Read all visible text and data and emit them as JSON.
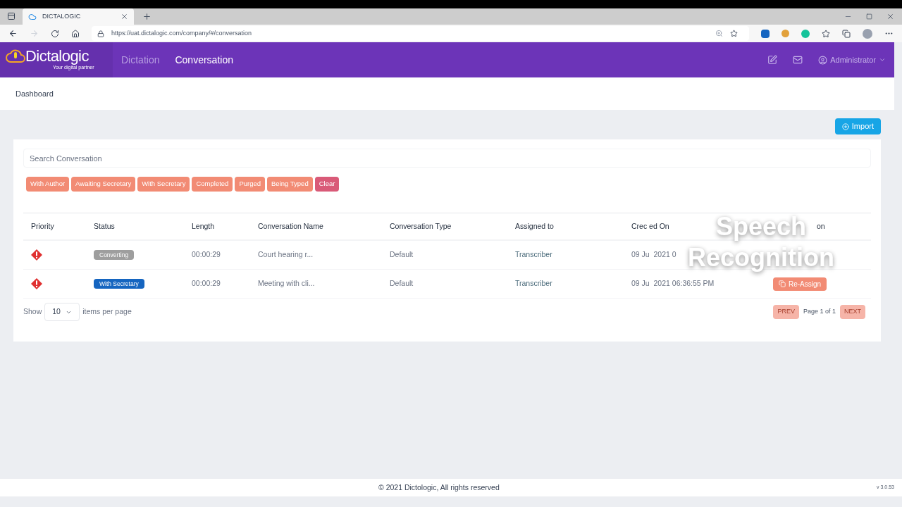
{
  "browser": {
    "tab_title": "DICTALOGIC",
    "url": "https://uat.dictalogic.com/company/#/conversation"
  },
  "header": {
    "logo": "Dictalogic",
    "tagline": "Your digital partner",
    "nav": [
      {
        "label": "Dictation",
        "selected": false
      },
      {
        "label": "Conversation",
        "selected": true
      }
    ],
    "user": "Administrator"
  },
  "breadcrumb": "Dashboard",
  "import_button": "Import",
  "search": {
    "placeholder": "Search Conversation"
  },
  "filters": [
    {
      "label": "With Author",
      "kind": "filter"
    },
    {
      "label": "Awaiting Secretary",
      "kind": "filter"
    },
    {
      "label": "With Secretary",
      "kind": "filter"
    },
    {
      "label": "Completed",
      "kind": "filter"
    },
    {
      "label": "Purged",
      "kind": "filter"
    },
    {
      "label": "Being Typed",
      "kind": "filter"
    },
    {
      "label": "Clear",
      "kind": "clear"
    }
  ],
  "table": {
    "columns": [
      "Priority",
      "Status",
      "Length",
      "Conversation Name",
      "Conversation Type",
      "Assigned to",
      "Crec ed On",
      "on"
    ],
    "rows": [
      {
        "status": "Converting",
        "color": "#9e9e9e",
        "length": "00:00:29",
        "name": "Court hearing r...",
        "type": "Default",
        "assigned": "Transcriber",
        "created": "09 Ju  2021 0",
        "action": null
      },
      {
        "status": "With Secretary",
        "color": "#1565c0",
        "length": "00:00:29",
        "name": "Meeting with cli...",
        "type": "Default",
        "assigned": "Transcriber",
        "created": "09 Ju  2021 06:36:55 PM",
        "action": "Re-Assign"
      }
    ]
  },
  "pagination": {
    "show": "Show",
    "per_page": "10",
    "items_label": "items per page",
    "prev": "PREV",
    "page": "Page 1 of 1",
    "next": "NEXT"
  },
  "overlay_caption": [
    "Speech",
    "Recognition"
  ],
  "footer": {
    "copyright": "© 2021 Dictologic, All rights reserved",
    "version": "v 3.0.53"
  }
}
